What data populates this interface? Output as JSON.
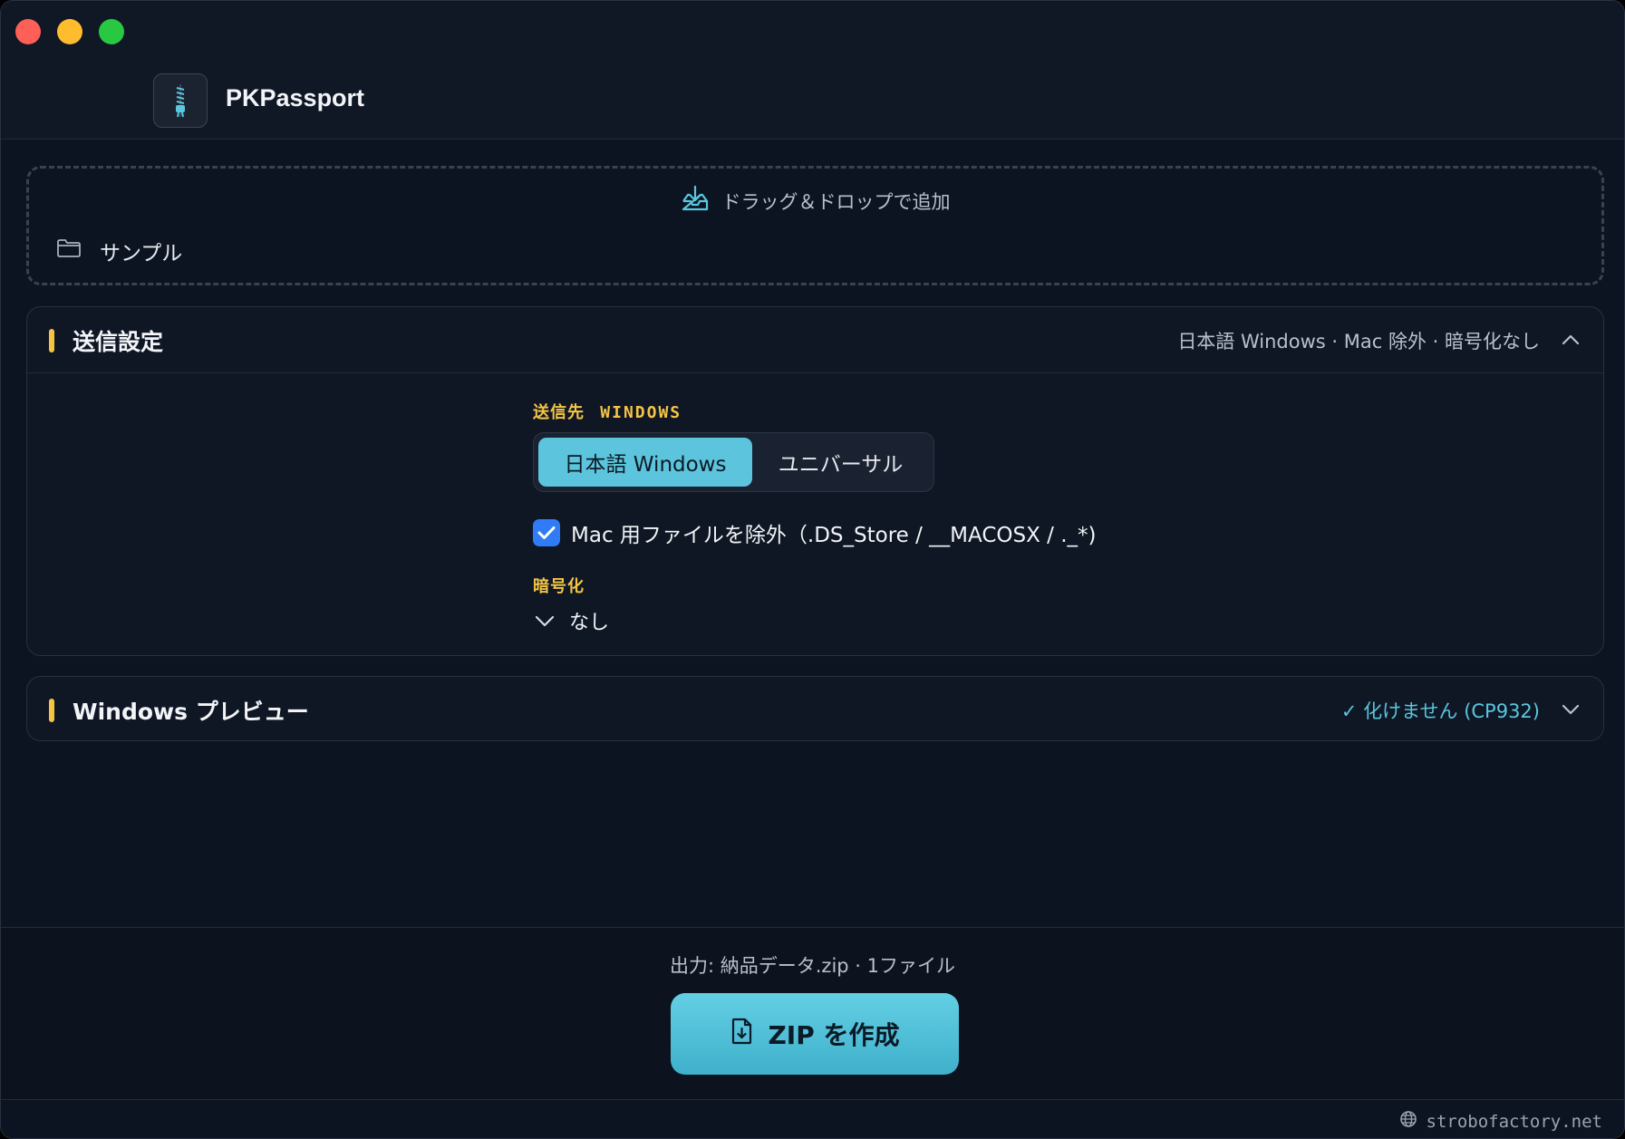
{
  "app": {
    "title": "PKPassport"
  },
  "dropzone": {
    "hint": "ドラッグ＆ドロップで追加",
    "file_name": "サンプル"
  },
  "send_settings": {
    "title": "送信設定",
    "summary": "日本語 Windows · Mac 除外 · 暗号化なし",
    "destination_label": "送信先",
    "destination_value": "WINDOWS",
    "segments": [
      "日本語 Windows",
      "ユニバーサル"
    ],
    "exclude_mac_checked": true,
    "exclude_mac_label": "Mac 用ファイルを除外（.DS_Store / __MACOSX / ._*)",
    "encryption_label": "暗号化",
    "encryption_value": "なし"
  },
  "preview": {
    "title": "Windows プレビュー",
    "status": "✓ 化けません (CP932)"
  },
  "output": {
    "info": "出力: 納品データ.zip · 1ファイル",
    "button_label": "ZIP を作成"
  },
  "footer": {
    "site": "strobofactory.net"
  },
  "colors": {
    "accent_yellow": "#f5c445",
    "accent_cyan": "#5cc4dc",
    "checkbox_blue": "#2f7cf6"
  }
}
